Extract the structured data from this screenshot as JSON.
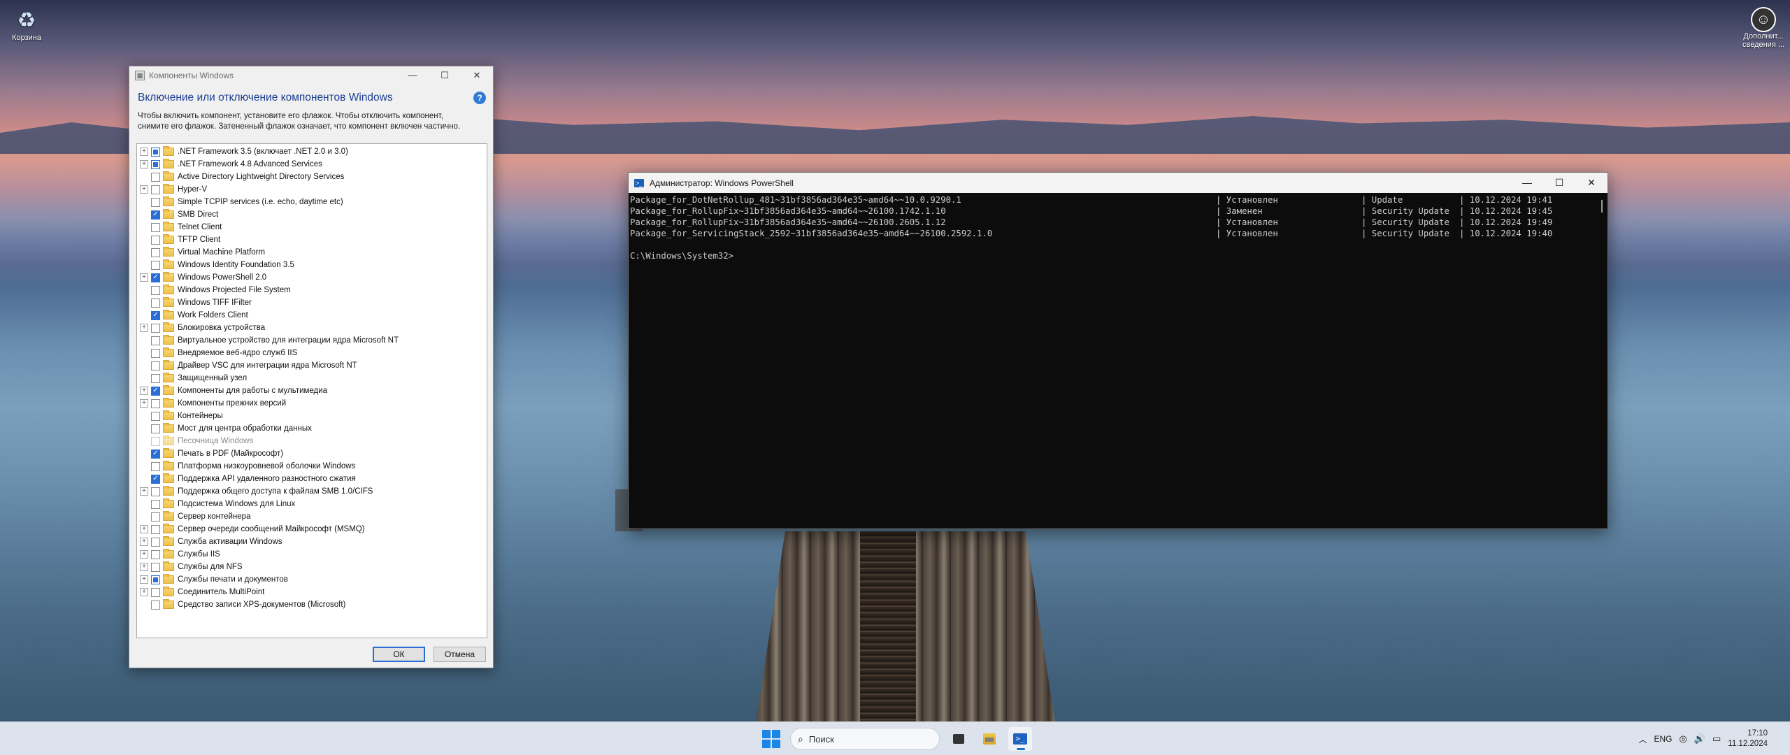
{
  "desktop": {
    "recycle_label": "Корзина",
    "user_info_label": "Дополнит... сведения ..."
  },
  "features": {
    "window_title": "Компоненты Windows",
    "heading": "Включение или отключение компонентов Windows",
    "description": "Чтобы включить компонент, установите его флажок. Чтобы отключить компонент, снимите его флажок. Затененный флажок означает, что компонент включен частично.",
    "help_label": "?",
    "ok_label": "ОК",
    "cancel_label": "Отмена",
    "items": [
      {
        "label": ".NET Framework 3.5 (включает .NET 2.0 и 3.0)",
        "expandable": true,
        "state": "partial"
      },
      {
        "label": ".NET Framework 4.8 Advanced Services",
        "expandable": true,
        "state": "partial"
      },
      {
        "label": "Active Directory Lightweight Directory Services",
        "expandable": false,
        "state": "unchecked"
      },
      {
        "label": "Hyper-V",
        "expandable": true,
        "state": "unchecked"
      },
      {
        "label": "Simple TCPIP services (i.e. echo, daytime etc)",
        "expandable": false,
        "state": "unchecked"
      },
      {
        "label": "SMB Direct",
        "expandable": false,
        "state": "checked"
      },
      {
        "label": "Telnet Client",
        "expandable": false,
        "state": "unchecked"
      },
      {
        "label": "TFTP Client",
        "expandable": false,
        "state": "unchecked"
      },
      {
        "label": "Virtual Machine Platform",
        "expandable": false,
        "state": "unchecked"
      },
      {
        "label": "Windows Identity Foundation 3.5",
        "expandable": false,
        "state": "unchecked"
      },
      {
        "label": "Windows PowerShell 2.0",
        "expandable": true,
        "state": "checked"
      },
      {
        "label": "Windows Projected File System",
        "expandable": false,
        "state": "unchecked"
      },
      {
        "label": "Windows TIFF IFilter",
        "expandable": false,
        "state": "unchecked"
      },
      {
        "label": "Work Folders Client",
        "expandable": false,
        "state": "checked"
      },
      {
        "label": "Блокировка устройства",
        "expandable": true,
        "state": "unchecked"
      },
      {
        "label": "Виртуальное устройство для интеграции ядра Microsoft NT",
        "expandable": false,
        "state": "unchecked"
      },
      {
        "label": "Внедряемое веб-ядро служб IIS",
        "expandable": false,
        "state": "unchecked"
      },
      {
        "label": "Драйвер VSC для интеграции ядра Microsoft NT",
        "expandable": false,
        "state": "unchecked"
      },
      {
        "label": "Защищенный узел",
        "expandable": false,
        "state": "unchecked"
      },
      {
        "label": "Компоненты для работы с мультимедиа",
        "expandable": true,
        "state": "checked"
      },
      {
        "label": "Компоненты прежних версий",
        "expandable": true,
        "state": "unchecked"
      },
      {
        "label": "Контейнеры",
        "expandable": false,
        "state": "unchecked"
      },
      {
        "label": "Мост для центра обработки данных",
        "expandable": false,
        "state": "unchecked"
      },
      {
        "label": "Песочница Windows",
        "expandable": false,
        "state": "disabled"
      },
      {
        "label": "Печать в PDF (Майкрософт)",
        "expandable": false,
        "state": "checked"
      },
      {
        "label": "Платформа низкоуровневой оболочки Windows",
        "expandable": false,
        "state": "unchecked"
      },
      {
        "label": "Поддержка API удаленного разностного сжатия",
        "expandable": false,
        "state": "checked"
      },
      {
        "label": "Поддержка общего доступа к файлам SMB 1.0/CIFS",
        "expandable": true,
        "state": "unchecked"
      },
      {
        "label": "Подсистема Windows для Linux",
        "expandable": false,
        "state": "unchecked"
      },
      {
        "label": "Сервер контейнера",
        "expandable": false,
        "state": "unchecked"
      },
      {
        "label": "Сервер очереди сообщений Майкрософт (MSMQ)",
        "expandable": true,
        "state": "unchecked"
      },
      {
        "label": "Служба активации Windows",
        "expandable": true,
        "state": "unchecked"
      },
      {
        "label": "Службы IIS",
        "expandable": true,
        "state": "unchecked"
      },
      {
        "label": "Службы для NFS",
        "expandable": true,
        "state": "unchecked"
      },
      {
        "label": "Службы печати и документов",
        "expandable": true,
        "state": "partial"
      },
      {
        "label": "Соединитель MultiPoint",
        "expandable": true,
        "state": "unchecked"
      },
      {
        "label": "Средство записи XPS-документов (Microsoft)",
        "expandable": false,
        "state": "unchecked"
      }
    ]
  },
  "powershell": {
    "window_title": "Администратор: Windows PowerShell",
    "rows": [
      {
        "package": "Package_for_DotNetRollup_481~31bf3856ad364e35~amd64~~10.0.9290.1",
        "state": "| Установлен",
        "type": "| Update",
        "date": "| 10.12.2024 19:41"
      },
      {
        "package": "Package_for_RollupFix~31bf3856ad364e35~amd64~~26100.1742.1.10",
        "state": "| Заменен",
        "type": "| Security Update",
        "date": "| 10.12.2024 19:45"
      },
      {
        "package": "Package_for_RollupFix~31bf3856ad364e35~amd64~~26100.2605.1.12",
        "state": "| Установлен",
        "type": "| Security Update",
        "date": "| 10.12.2024 19:49"
      },
      {
        "package": "Package_for_ServicingStack_2592~31bf3856ad364e35~amd64~~26100.2592.1.0",
        "state": "| Установлен",
        "type": "| Security Update",
        "date": "| 10.12.2024 19:40"
      }
    ],
    "prompt": "C:\\Windows\\System32>"
  },
  "taskbar": {
    "search_placeholder": "Поиск",
    "lang": "ENG",
    "time": "17:10",
    "date": "11.12.2024"
  }
}
